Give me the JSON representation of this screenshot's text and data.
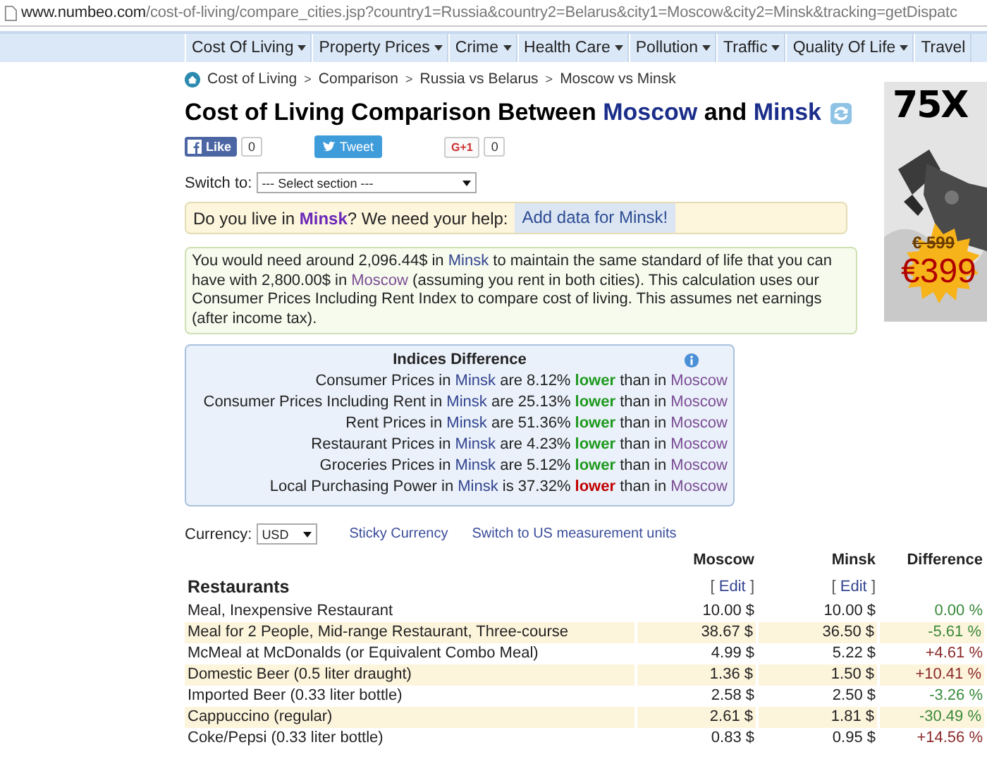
{
  "address_bar": {
    "host": "www.numbeo.com",
    "path": "/cost-of-living/compare_cities.jsp?country1=Russia&country2=Belarus&city1=Moscow&city2=Minsk&tracking=getDispatc"
  },
  "nav": [
    {
      "label": "Cost Of Living",
      "has_menu": true
    },
    {
      "label": "Property Prices",
      "has_menu": true
    },
    {
      "label": "Crime",
      "has_menu": true
    },
    {
      "label": "Health Care",
      "has_menu": true
    },
    {
      "label": "Pollution",
      "has_menu": true
    },
    {
      "label": "Traffic",
      "has_menu": true
    },
    {
      "label": "Quality Of Life",
      "has_menu": true
    },
    {
      "label": "Travel",
      "has_menu": false
    }
  ],
  "breadcrumb": [
    "Cost of Living",
    "Comparison",
    "Russia vs Belarus",
    "Moscow vs Minsk"
  ],
  "breadcrumb_separator": ">",
  "title": {
    "prefix": "Cost of Living Comparison Between",
    "city1": "Moscow",
    "joiner": "and",
    "city2": "Minsk"
  },
  "social": {
    "like": {
      "label": "Like",
      "count": "0"
    },
    "tweet": {
      "label": "Tweet"
    },
    "plus": {
      "label": "G+1",
      "count": "0"
    }
  },
  "switch": {
    "label": "Switch to:",
    "placeholder": "--- Select section ---"
  },
  "help": {
    "before": "Do you live in ",
    "city": "Minsk",
    "after": "? We need your help:",
    "button": "Add data for Minsk!"
  },
  "summary": [
    {
      "text": "You would need around 2,096.44$ in ",
      "kind": "plain"
    },
    {
      "text": "Minsk",
      "kind": "link",
      "visited": false
    },
    {
      "text": " to maintain the same standard of life that you can have with 2,800.00$ in ",
      "kind": "plain"
    },
    {
      "text": "Moscow",
      "kind": "link",
      "visited": true
    },
    {
      "text": " (assuming you rent in both cities). This calculation uses our Consumer Prices Including Rent Index to compare cost of living. This assumes net earnings (after income tax).",
      "kind": "plain"
    }
  ],
  "indices": {
    "title": "Indices Difference",
    "rows": [
      {
        "label": "Consumer Prices in",
        "city": "Minsk",
        "verb": "are 8.12%",
        "direction": "lower",
        "color": "#1f9a1f",
        "tail": "than in",
        "compare": "Moscow"
      },
      {
        "label": "Consumer Prices Including Rent in",
        "city": "Minsk",
        "verb": "are 25.13%",
        "direction": "lower",
        "color": "#1f9a1f",
        "tail": "than in",
        "compare": "Moscow"
      },
      {
        "label": "Rent Prices in",
        "city": "Minsk",
        "verb": "are 51.36%",
        "direction": "lower",
        "color": "#1f9a1f",
        "tail": "than in",
        "compare": "Moscow"
      },
      {
        "label": "Restaurant Prices in",
        "city": "Minsk",
        "verb": "are 4.23%",
        "direction": "lower",
        "color": "#1f9a1f",
        "tail": "than in",
        "compare": "Moscow"
      },
      {
        "label": "Groceries Prices in",
        "city": "Minsk",
        "verb": "are 5.12%",
        "direction": "lower",
        "color": "#1f9a1f",
        "tail": "than in",
        "compare": "Moscow"
      },
      {
        "label": "Local Purchasing Power in",
        "city": "Minsk",
        "verb": "is 37.32%",
        "direction": "lower",
        "color": "#c00000",
        "tail": "than in",
        "compare": "Moscow"
      }
    ]
  },
  "currency": {
    "label": "Currency:",
    "value": "USD",
    "links": [
      "Sticky Currency",
      "Switch to US measurement units"
    ]
  },
  "table": {
    "columns": [
      "Moscow",
      "Minsk",
      "Difference"
    ],
    "section": "Restaurants",
    "edit": [
      {
        "open": "[",
        "label": "Edit",
        "close": "]"
      },
      {
        "open": "[",
        "label": "Edit",
        "close": "]"
      }
    ],
    "rows": [
      {
        "item": "Meal, Inexpensive Restaurant",
        "moscow": "10.00 $",
        "minsk": "10.00 $",
        "difference": "0.00 %",
        "color": "#3a8a3a"
      },
      {
        "item": "Meal for 2 People, Mid-range Restaurant, Three-course",
        "moscow": "38.67 $",
        "minsk": "36.50 $",
        "difference": "-5.61 %",
        "color": "#3a8a3a"
      },
      {
        "item": "McMeal at McDonalds (or Equivalent Combo Meal)",
        "moscow": "4.99 $",
        "minsk": "5.22 $",
        "difference": "+4.61 %",
        "color": "#8a2a2a"
      },
      {
        "item": "Domestic Beer (0.5 liter draught)",
        "moscow": "1.36 $",
        "minsk": "1.50 $",
        "difference": "+10.41 %",
        "color": "#8a2a2a"
      },
      {
        "item": "Imported Beer (0.33 liter bottle)",
        "moscow": "2.58 $",
        "minsk": "2.50 $",
        "difference": "-3.26 %",
        "color": "#3a8a3a"
      },
      {
        "item": "Cappuccino (regular)",
        "moscow": "2.61 $",
        "minsk": "1.81 $",
        "difference": "-30.49 %",
        "color": "#3a8a3a"
      },
      {
        "item": "Coke/Pepsi (0.33 liter bottle)",
        "moscow": "0.83 $",
        "minsk": "0.95 $",
        "difference": "+14.56 %",
        "color": "#8a2a2a"
      }
    ]
  },
  "ad": {
    "headline": "75X",
    "old_price": "€ 599",
    "price": "€399"
  }
}
